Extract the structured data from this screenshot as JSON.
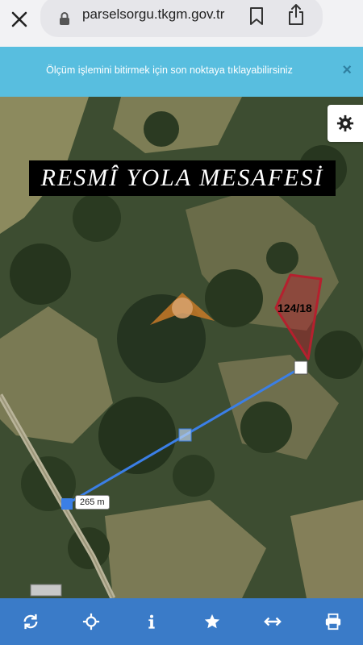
{
  "browser": {
    "url": "parselsorgu.tkgm.gov.tr",
    "icons": [
      "close-icon",
      "lock-icon",
      "bookmark-icon",
      "share-icon"
    ]
  },
  "banner": {
    "message": "Ölçüm işlemini bitirmek için son noktaya tıklayabilirsiniz",
    "close_symbol": "×",
    "background": "#58bedf"
  },
  "map": {
    "overlay_title": "RESMÎ YOLA MESAFESİ",
    "parcel_label": "124/18",
    "parcel_color": "#b5202e",
    "measure_line_color": "#3b7fe6",
    "distance_label": "265 m",
    "settings_icon": "gear-icon"
  },
  "toolbar": {
    "background": "#3a7bc8",
    "buttons": [
      {
        "name": "refresh",
        "icon": "refresh-icon"
      },
      {
        "name": "locate",
        "icon": "crosshair-icon"
      },
      {
        "name": "info",
        "icon": "info-icon"
      },
      {
        "name": "favorite",
        "icon": "star-icon"
      },
      {
        "name": "measure",
        "icon": "measure-icon"
      },
      {
        "name": "print",
        "icon": "print-icon"
      }
    ]
  }
}
